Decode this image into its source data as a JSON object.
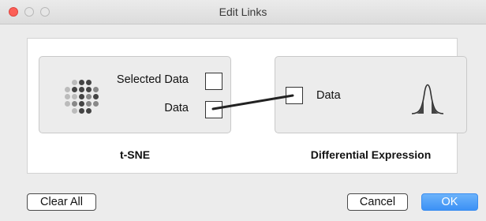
{
  "window": {
    "title": "Edit Links"
  },
  "nodes": {
    "left": {
      "name": "t-SNE",
      "ports": [
        {
          "label": "Selected Data"
        },
        {
          "label": "Data"
        }
      ]
    },
    "right": {
      "name": "Differential Expression",
      "ports": [
        {
          "label": "Data"
        }
      ]
    }
  },
  "buttons": {
    "clear_all": "Clear All",
    "cancel": "Cancel",
    "ok": "OK"
  },
  "icons": {
    "left_node": "scatter-dots-icon",
    "right_node": "bell-curve-icon"
  }
}
